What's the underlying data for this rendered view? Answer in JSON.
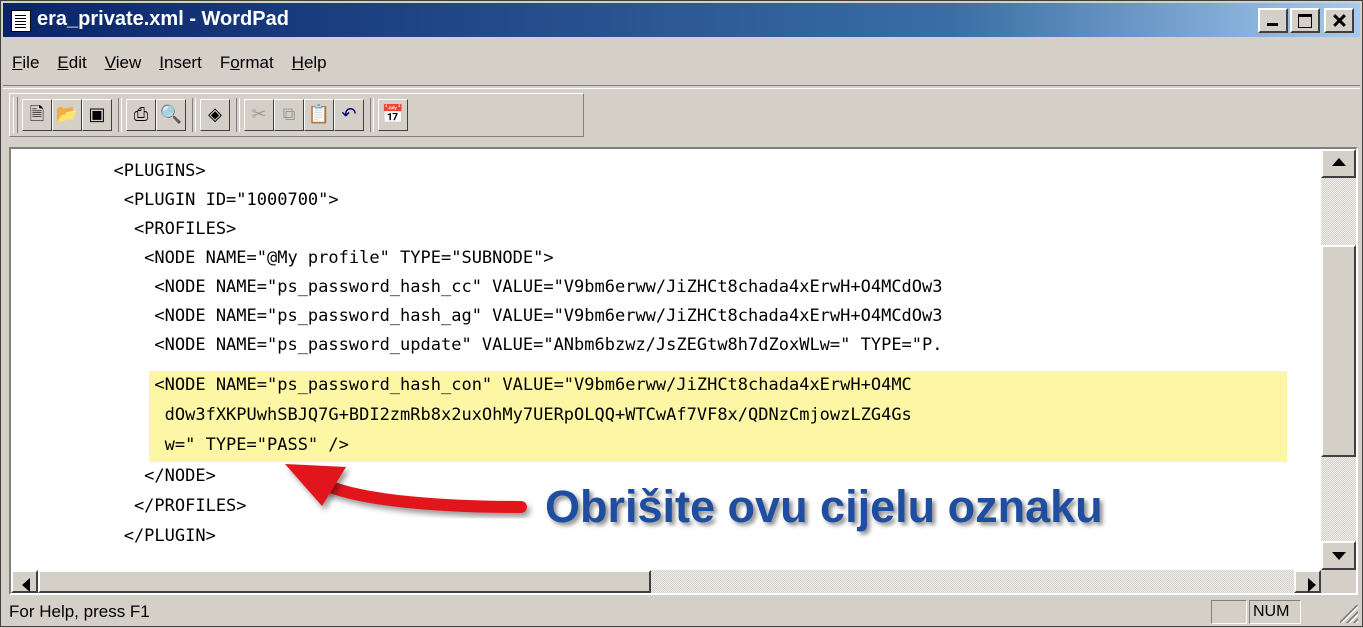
{
  "window": {
    "title": "era_private.xml - WordPad"
  },
  "menu": [
    "File",
    "Edit",
    "View",
    "Insert",
    "Format",
    "Help"
  ],
  "toolbar": {
    "buttons": [
      "new-icon",
      "open-icon",
      "save-icon",
      "print-icon",
      "print-preview-icon",
      "find-icon",
      "cut-icon",
      "copy-icon",
      "paste-icon",
      "undo-icon",
      "insert-date-time-icon"
    ]
  },
  "document": {
    "lines": [
      "  <PLUGINS>",
      "   <PLUGIN ID=\"1000700\">",
      "    <PROFILES>",
      "     <NODE NAME=\"@My profile\" TYPE=\"SUBNODE\">",
      "      <NODE NAME=\"ps_password_hash_cc\" VALUE=\"V9bm6erww/JiZHCt8chada4xErwH+O4MCdOw3",
      "      <NODE NAME=\"ps_password_hash_ag\" VALUE=\"V9bm6erww/JiZHCt8chada4xErwH+O4MCdOw3",
      "      <NODE NAME=\"ps_password_update\" VALUE=\"ANbm6bzwz/JsZEGtw8h7dZoxWLw=\" TYPE=\"P.",
      "      <NODE NAME=\"ps_password_hash_con\" VALUE=\"V9bm6erww/JiZHCt8chada4xErwH+O4MC",
      "       dOw3fXKPUwhSBJQ7G+BDI2zmRb8x2uxOhMy7UERpOLQQ+WTCwAf7VF8x/QDNzCmjowzLZG4Gs",
      "       w=\" TYPE=\"PASS\" />",
      "     </NODE>",
      "    </PROFILES>",
      "   </PLUGIN>"
    ],
    "highlighted_lines": [
      7,
      8,
      9
    ],
    "highlight_color": "#fdf6a4"
  },
  "annotation": {
    "text": "Obrišite ovu cijelu oznaku",
    "text_color": "#1f4ea0",
    "arrow_color": "#e0141e"
  },
  "statusbar": {
    "help_text": "For Help, press F1",
    "num_indicator": "NUM"
  }
}
